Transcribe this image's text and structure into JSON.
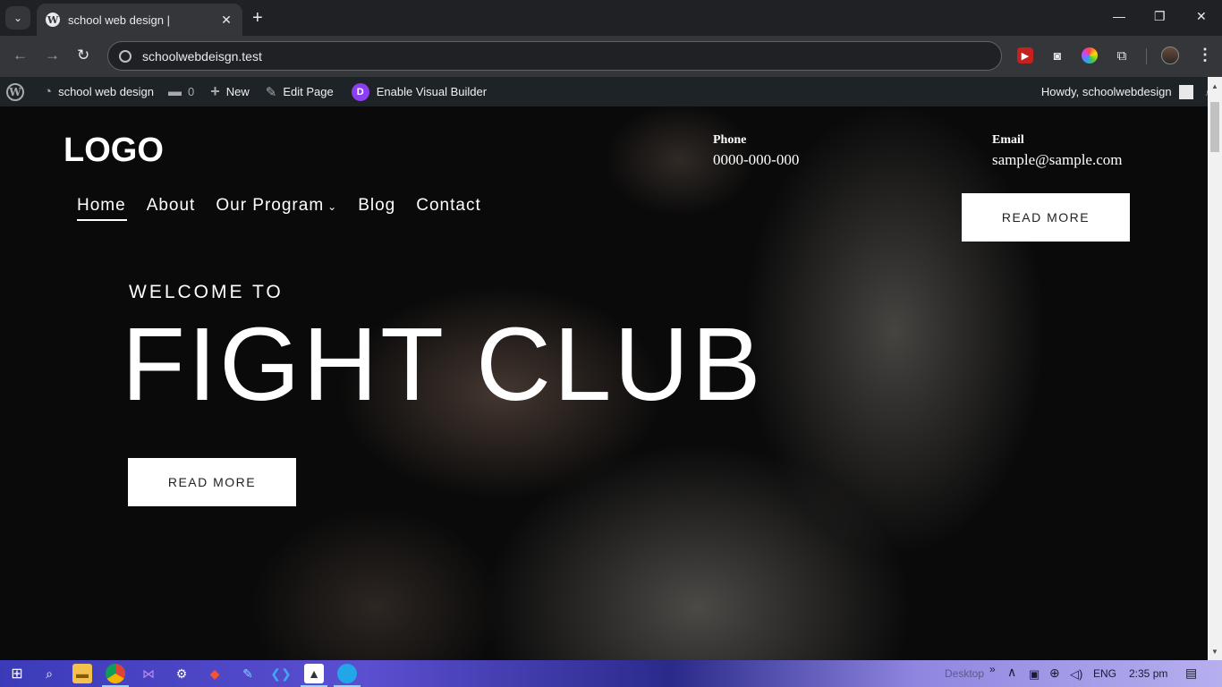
{
  "browser": {
    "tab_title": "school web design |",
    "url": "schoolwebdeisgn.test",
    "new_tab": "+",
    "minimize": "—",
    "restore": "❐",
    "close": "✕"
  },
  "adminbar": {
    "site_name": "school web design",
    "comments_count": "0",
    "new_label": "New",
    "edit_label": "Edit Page",
    "visual_builder_label": "Enable Visual Builder",
    "howdy": "Howdy, schoolwebdesign"
  },
  "site": {
    "logo": "LOGO",
    "phone_label": "Phone",
    "phone_value": "0000-000-000",
    "email_label": "Email",
    "email_value": "sample@sample.com",
    "nav": [
      {
        "label": "Home"
      },
      {
        "label": "About"
      },
      {
        "label": "Our Program"
      },
      {
        "label": "Blog"
      },
      {
        "label": "Contact"
      }
    ],
    "header_button": "READ MORE",
    "welcome": "WELCOME TO",
    "hero_title": "FIGHT CLUB",
    "hero_button": "READ MORE"
  },
  "taskbar": {
    "desktop_label": "Desktop",
    "lang": "ENG",
    "time": "2:35 pm"
  },
  "colors": {
    "admin_bar": "#1d2327",
    "chrome_toolbar": "#35363a",
    "divi_purple": "#8c3ff0"
  }
}
